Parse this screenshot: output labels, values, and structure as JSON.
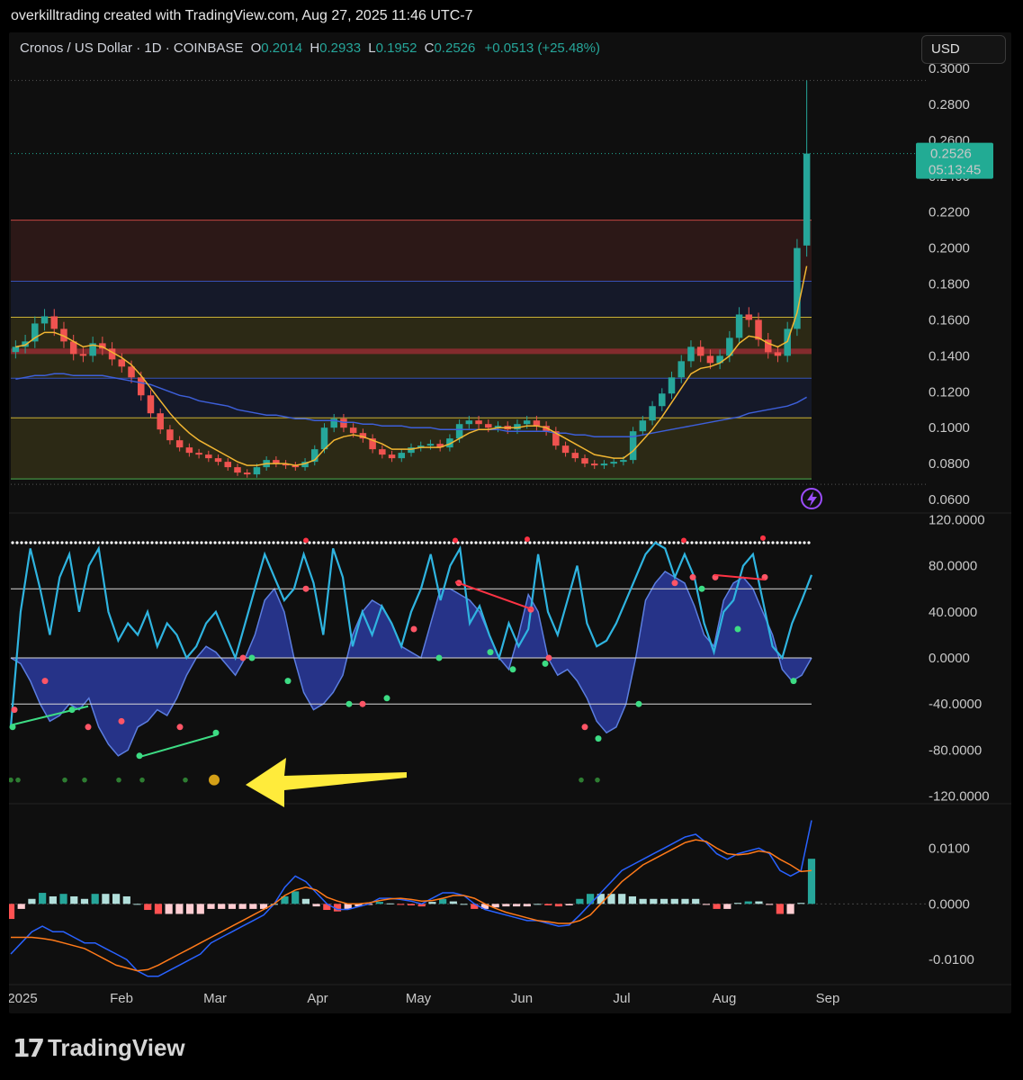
{
  "header": {
    "created_line": "overkilltrading created with TradingView.com, Aug 27, 2025 11:46 UTC-7"
  },
  "legend": {
    "symbol": "Cronos / US Dollar · 1D · COINBASE",
    "o_label": "O",
    "o_value": "0.2014",
    "h_label": "H",
    "h_value": "0.2933",
    "l_label": "L",
    "l_value": "0.1952",
    "c_label": "C",
    "c_value": "0.2526",
    "change": "+0.0513 (+25.48%)"
  },
  "currency_button": "USD",
  "price_badge": {
    "price": "0.2526",
    "countdown": "05:13:45"
  },
  "footer_brand": "TradingView",
  "colors": {
    "up": "#26a69a",
    "down": "#ef5350",
    "ema_fast": "#f2b632",
    "ma_slow": "#3d5fd9",
    "wave_line": "#2fb4e0",
    "wave_fill": "#2a3a9e",
    "macd": "#2962ff",
    "signal": "#ff7a1a",
    "badge": "#22ab94",
    "arrow": "#ffeb3b"
  },
  "chart_data": [
    {
      "type": "candlestick",
      "title": "Cronos / US Dollar · 1D · COINBASE",
      "x_labels": [
        "2025",
        "Feb",
        "Mar",
        "Apr",
        "May",
        "Jun",
        "Jul",
        "Aug",
        "Sep"
      ],
      "y_ticks": [
        "0.3000",
        "0.2800",
        "0.2600",
        "0.2400",
        "0.2200",
        "0.2000",
        "0.1800",
        "0.1600",
        "0.1400",
        "0.1200",
        "0.1000",
        "0.0800",
        "0.0600"
      ],
      "ylim": [
        0.052,
        0.3
      ],
      "last_price": 0.2526,
      "ohlc_last": {
        "open": 0.2014,
        "high": 0.2933,
        "low": 0.1952,
        "close": 0.2526
      },
      "close_series": [
        0.145,
        0.148,
        0.158,
        0.162,
        0.155,
        0.148,
        0.141,
        0.14,
        0.147,
        0.144,
        0.138,
        0.134,
        0.128,
        0.118,
        0.108,
        0.099,
        0.093,
        0.089,
        0.086,
        0.085,
        0.083,
        0.081,
        0.078,
        0.075,
        0.074,
        0.078,
        0.082,
        0.08,
        0.079,
        0.078,
        0.081,
        0.088,
        0.1,
        0.105,
        0.1,
        0.097,
        0.094,
        0.088,
        0.085,
        0.083,
        0.086,
        0.089,
        0.09,
        0.091,
        0.089,
        0.094,
        0.102,
        0.104,
        0.102,
        0.1,
        0.101,
        0.099,
        0.102,
        0.104,
        0.101,
        0.098,
        0.09,
        0.086,
        0.083,
        0.08,
        0.079,
        0.08,
        0.081,
        0.082,
        0.098,
        0.104,
        0.112,
        0.119,
        0.128,
        0.137,
        0.145,
        0.14,
        0.136,
        0.14,
        0.15,
        0.163,
        0.16,
        0.149,
        0.142,
        0.14,
        0.155,
        0.2,
        0.2526
      ],
      "ema_fast": [
        0.145,
        0.146,
        0.15,
        0.153,
        0.153,
        0.151,
        0.148,
        0.145,
        0.146,
        0.145,
        0.142,
        0.139,
        0.135,
        0.129,
        0.122,
        0.115,
        0.108,
        0.102,
        0.097,
        0.093,
        0.09,
        0.087,
        0.084,
        0.081,
        0.079,
        0.079,
        0.08,
        0.08,
        0.08,
        0.079,
        0.08,
        0.082,
        0.088,
        0.093,
        0.095,
        0.096,
        0.095,
        0.093,
        0.091,
        0.088,
        0.088,
        0.088,
        0.089,
        0.089,
        0.089,
        0.091,
        0.094,
        0.097,
        0.099,
        0.099,
        0.1,
        0.1,
        0.1,
        0.101,
        0.101,
        0.1,
        0.097,
        0.094,
        0.091,
        0.088,
        0.085,
        0.084,
        0.083,
        0.083,
        0.087,
        0.093,
        0.099,
        0.106,
        0.114,
        0.122,
        0.13,
        0.133,
        0.134,
        0.136,
        0.14,
        0.147,
        0.151,
        0.15,
        0.147,
        0.145,
        0.148,
        0.164,
        0.19
      ],
      "ma_slow": [
        0.127,
        0.128,
        0.129,
        0.129,
        0.13,
        0.13,
        0.129,
        0.129,
        0.129,
        0.129,
        0.128,
        0.127,
        0.126,
        0.125,
        0.124,
        0.122,
        0.12,
        0.118,
        0.117,
        0.115,
        0.114,
        0.113,
        0.112,
        0.11,
        0.109,
        0.108,
        0.107,
        0.107,
        0.106,
        0.105,
        0.105,
        0.104,
        0.104,
        0.104,
        0.103,
        0.103,
        0.102,
        0.102,
        0.101,
        0.101,
        0.101,
        0.1,
        0.1,
        0.1,
        0.099,
        0.099,
        0.099,
        0.099,
        0.099,
        0.099,
        0.099,
        0.098,
        0.098,
        0.098,
        0.098,
        0.098,
        0.097,
        0.097,
        0.096,
        0.096,
        0.095,
        0.095,
        0.095,
        0.095,
        0.095,
        0.096,
        0.097,
        0.098,
        0.099,
        0.1,
        0.101,
        0.102,
        0.103,
        0.104,
        0.105,
        0.106,
        0.108,
        0.109,
        0.11,
        0.111,
        0.112,
        0.114,
        0.117
      ],
      "bands": [
        {
          "top": 0.2155,
          "bottom": 0.1815,
          "color": "#ef5350"
        },
        {
          "top": 0.1815,
          "bottom": 0.1615,
          "color": "#3d5fd9"
        },
        {
          "top": 0.1615,
          "bottom": 0.1275,
          "color": "#f2d53c"
        },
        {
          "top": 0.1275,
          "bottom": 0.1055,
          "color": "#3d5fd9"
        },
        {
          "top": 0.1055,
          "bottom": 0.0715,
          "color": "#f2d53c"
        }
      ],
      "red_level": 0.1425
    },
    {
      "type": "oscillator",
      "y_ticks": [
        "120.0000",
        "80.0000",
        "40.0000",
        "0.0000",
        "-40.0000",
        "-80.0000",
        "-120.0000"
      ],
      "ylim": [
        -125,
        125
      ],
      "levels": [
        60,
        0,
        -40
      ],
      "dotted_level": 100,
      "fast_line": [
        -60,
        40,
        95,
        60,
        20,
        70,
        90,
        40,
        80,
        95,
        40,
        15,
        30,
        20,
        40,
        10,
        30,
        20,
        0,
        10,
        30,
        40,
        20,
        0,
        30,
        60,
        90,
        70,
        50,
        60,
        90,
        65,
        20,
        95,
        70,
        10,
        40,
        20,
        45,
        30,
        10,
        40,
        60,
        90,
        50,
        80,
        95,
        30,
        45,
        20,
        0,
        30,
        10,
        25,
        90,
        40,
        20,
        50,
        80,
        30,
        10,
        15,
        30,
        50,
        70,
        90,
        100,
        95,
        70,
        90,
        70,
        30,
        5,
        40,
        50,
        80,
        90,
        50,
        10,
        0,
        30,
        50,
        72
      ],
      "wave_area": [
        0,
        -5,
        -20,
        -40,
        -55,
        -50,
        -40,
        -45,
        -35,
        -60,
        -75,
        -85,
        -80,
        -60,
        -55,
        -45,
        -50,
        -35,
        -15,
        0,
        10,
        5,
        -5,
        -15,
        0,
        20,
        50,
        60,
        40,
        0,
        -30,
        -45,
        -40,
        -30,
        -15,
        20,
        40,
        50,
        45,
        30,
        10,
        5,
        0,
        30,
        60,
        60,
        55,
        50,
        40,
        20,
        0,
        -10,
        20,
        55,
        40,
        0,
        -15,
        -10,
        -20,
        -35,
        -55,
        -65,
        -60,
        -40,
        0,
        50,
        65,
        75,
        70,
        65,
        45,
        20,
        10,
        50,
        65,
        70,
        60,
        40,
        20,
        -10,
        -20,
        -15,
        0
      ],
      "green_dots_bottom": 9,
      "yellow_marker": {
        "value": -106
      }
    },
    {
      "type": "macd",
      "y_ticks": [
        "0.0100",
        "0.0000",
        "-0.0100"
      ],
      "ylim": [
        -0.014,
        0.0175
      ],
      "macd": [
        -0.009,
        -0.007,
        -0.005,
        -0.004,
        -0.005,
        -0.005,
        -0.006,
        -0.007,
        -0.007,
        -0.008,
        -0.009,
        -0.01,
        -0.012,
        -0.013,
        -0.013,
        -0.012,
        -0.011,
        -0.01,
        -0.009,
        -0.007,
        -0.006,
        -0.005,
        -0.004,
        -0.003,
        -0.002,
        0.0,
        0.003,
        0.005,
        0.004,
        0.002,
        0.0,
        -0.001,
        -0.001,
        -0.0005,
        0.0,
        0.001,
        0.001,
        0.0008,
        0.0005,
        0.0,
        0.001,
        0.002,
        0.002,
        0.0015,
        0.0,
        -0.001,
        -0.0015,
        -0.002,
        -0.0025,
        -0.003,
        -0.003,
        -0.0035,
        -0.004,
        -0.0038,
        -0.002,
        0.0,
        0.002,
        0.004,
        0.006,
        0.007,
        0.008,
        0.009,
        0.01,
        0.011,
        0.012,
        0.0125,
        0.011,
        0.009,
        0.008,
        0.009,
        0.0095,
        0.01,
        0.009,
        0.006,
        0.005,
        0.006,
        0.015
      ],
      "signal": [
        -0.006,
        -0.006,
        -0.006,
        -0.0062,
        -0.0065,
        -0.007,
        -0.0075,
        -0.008,
        -0.009,
        -0.01,
        -0.011,
        -0.0115,
        -0.012,
        -0.0118,
        -0.011,
        -0.01,
        -0.009,
        -0.008,
        -0.007,
        -0.006,
        -0.005,
        -0.004,
        -0.003,
        -0.002,
        -0.001,
        0.0,
        0.0015,
        0.0025,
        0.003,
        0.0025,
        0.0012,
        0.0005,
        0.0,
        0.0,
        0.0002,
        0.0006,
        0.0009,
        0.001,
        0.0008,
        0.0005,
        0.0006,
        0.001,
        0.0015,
        0.0015,
        0.001,
        0.0,
        -0.0008,
        -0.0015,
        -0.002,
        -0.0025,
        -0.003,
        -0.0032,
        -0.0035,
        -0.0035,
        -0.003,
        -0.002,
        0.0,
        0.002,
        0.004,
        0.0055,
        0.007,
        0.008,
        0.009,
        0.01,
        0.011,
        0.0115,
        0.0112,
        0.01,
        0.009,
        0.0088,
        0.009,
        0.0095,
        0.0092,
        0.008,
        0.007,
        0.0058,
        0.006
      ]
    }
  ]
}
